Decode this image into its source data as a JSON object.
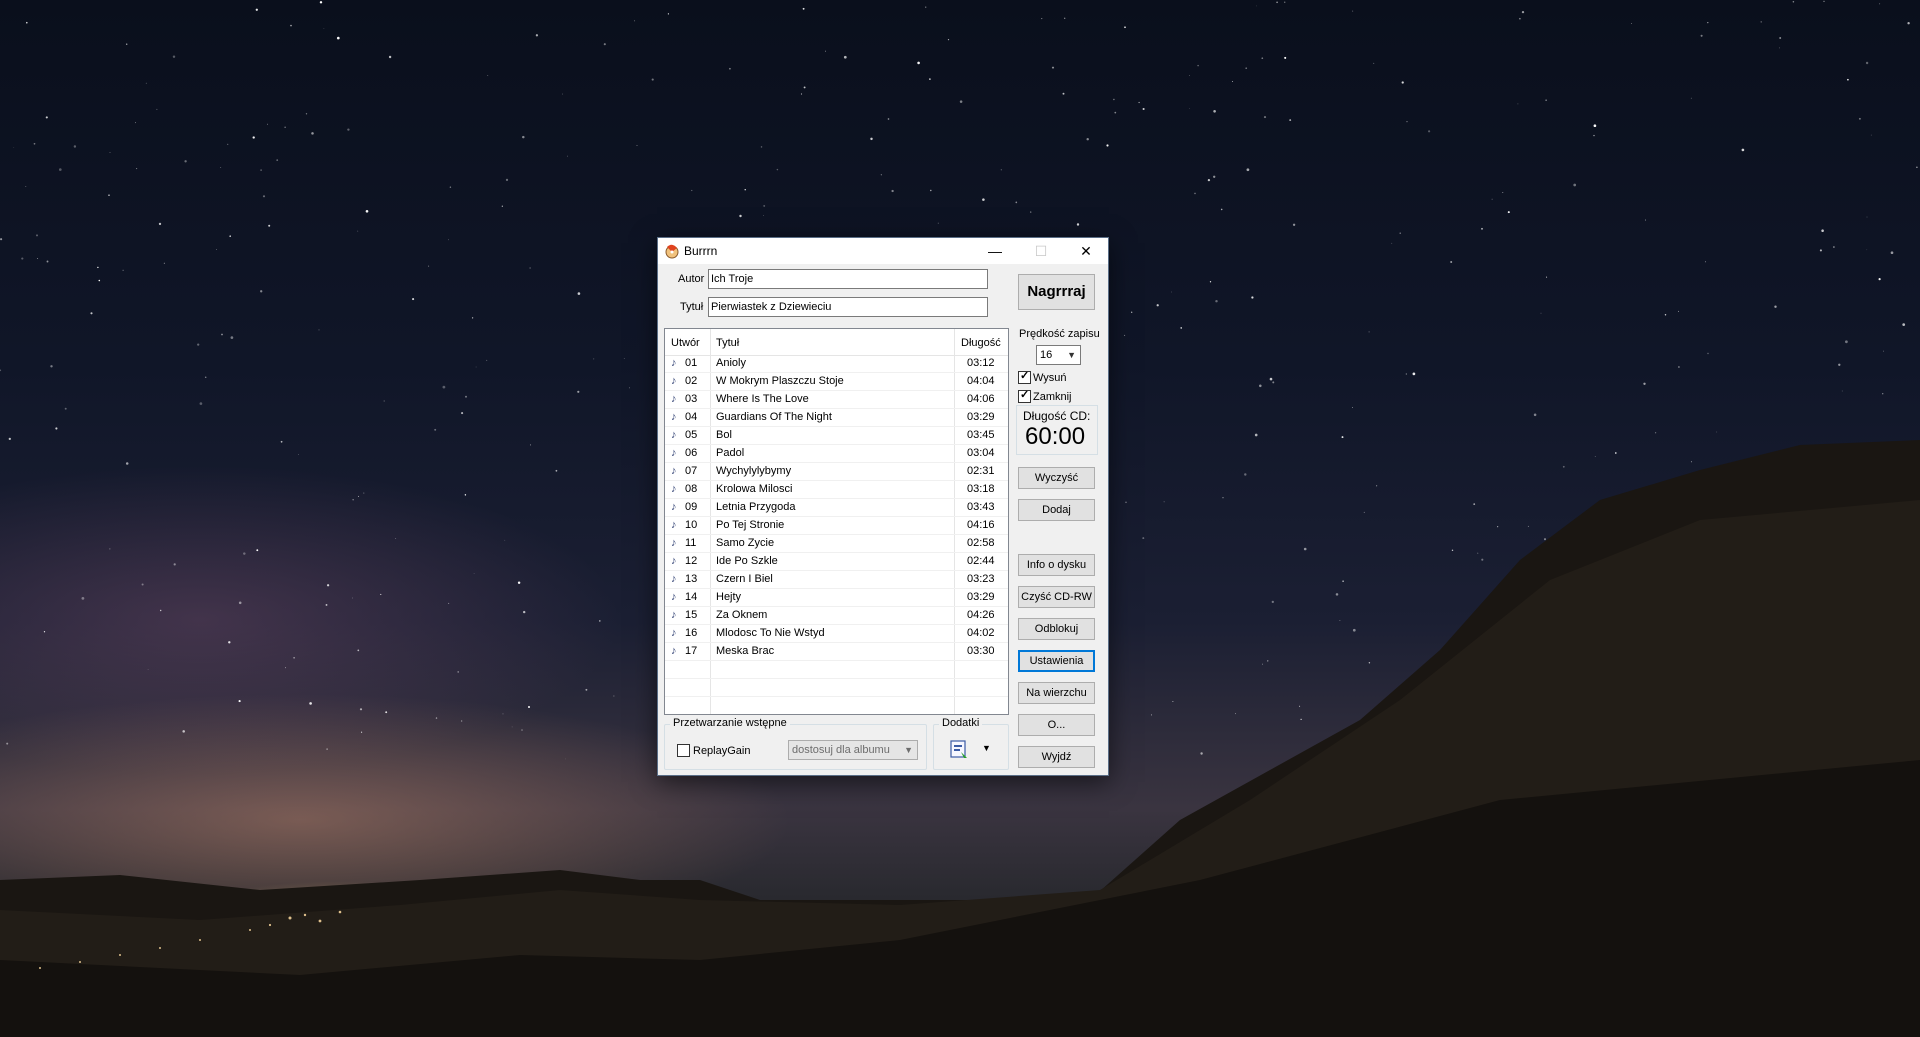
{
  "window": {
    "title": "Burrrn",
    "controls": {
      "minimize": "—",
      "maximize": "☐",
      "close": "✕"
    }
  },
  "form": {
    "author_label": "Autor",
    "author_value": "Ich Troje",
    "title_label": "Tytuł",
    "title_value": "Pierwiastek z Dziewieciu"
  },
  "tracklist": {
    "columns": [
      "Utwór",
      "Tytuł",
      "Długość"
    ],
    "rows": [
      {
        "num": "01",
        "title": "Anioly",
        "length": "03:12"
      },
      {
        "num": "02",
        "title": "W Mokrym Plaszczu Stoje",
        "length": "04:04"
      },
      {
        "num": "03",
        "title": "Where Is The Love",
        "length": "04:06"
      },
      {
        "num": "04",
        "title": "Guardians Of The Night",
        "length": "03:29"
      },
      {
        "num": "05",
        "title": "Bol",
        "length": "03:45"
      },
      {
        "num": "06",
        "title": "Padol",
        "length": "03:04"
      },
      {
        "num": "07",
        "title": "Wychylylybymy",
        "length": "02:31"
      },
      {
        "num": "08",
        "title": "Krolowa Milosci",
        "length": "03:18"
      },
      {
        "num": "09",
        "title": "Letnia Przygoda",
        "length": "03:43"
      },
      {
        "num": "10",
        "title": "Po Tej Stronie",
        "length": "04:16"
      },
      {
        "num": "11",
        "title": "Samo Zycie",
        "length": "02:58"
      },
      {
        "num": "12",
        "title": "Ide Po Szkle",
        "length": "02:44"
      },
      {
        "num": "13",
        "title": "Czern I Biel",
        "length": "03:23"
      },
      {
        "num": "14",
        "title": "Hejty",
        "length": "03:29"
      },
      {
        "num": "15",
        "title": "Za Oknem",
        "length": "04:26"
      },
      {
        "num": "16",
        "title": "Mlodosc To Nie Wstyd",
        "length": "04:02"
      },
      {
        "num": "17",
        "title": "Meska Brac",
        "length": "03:30"
      }
    ]
  },
  "preprocessing": {
    "caption": "Przetwarzanie wstępne",
    "replaygain_label": "ReplayGain",
    "replaygain_checked": false,
    "mode_value": "dostosuj dla albumu"
  },
  "addons": {
    "caption": "Dodatki"
  },
  "side": {
    "burn_button": "Nagrrraj",
    "speed_label": "Prędkość zapisu",
    "speed_value": "16",
    "eject_label": "Wysuń",
    "eject_checked": true,
    "close_label": "Zamknij",
    "close_checked": true,
    "cd_length_label": "Długość CD:",
    "cd_length_value": "60:00",
    "buttons": {
      "clear": "Wyczyść",
      "add": "Dodaj",
      "disc_info": "Info o dysku",
      "erase_cdrw": "Czyść CD-RW",
      "unlock": "Odblokuj",
      "settings": "Ustawienia",
      "on_top": "Na wierzchu",
      "about": "O...",
      "exit": "Wyjdź"
    }
  }
}
